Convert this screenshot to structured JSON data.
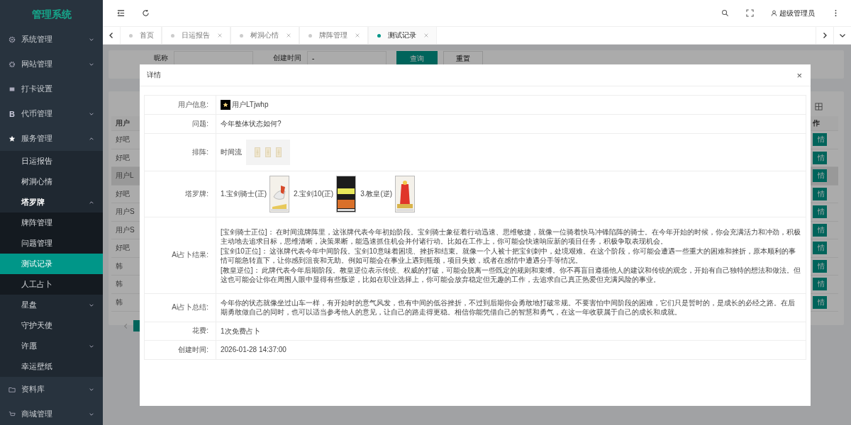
{
  "sidebar": {
    "title": "管理系统",
    "items": [
      {
        "label": "系统管理",
        "expanded": false,
        "selected": false
      },
      {
        "label": "网站管理",
        "expanded": false,
        "selected": false
      },
      {
        "label": "打卡设置",
        "selected": false
      },
      {
        "label": "代币管理",
        "glyph": "B",
        "expanded": false,
        "selected": false
      },
      {
        "label": "服务管理",
        "expanded": true,
        "selected": false,
        "children": [
          {
            "label": "日运报告",
            "selected": false
          },
          {
            "label": "树洞心情",
            "selected": false
          },
          {
            "label": "塔罗牌",
            "expanded": true,
            "selected": false,
            "children": [
              {
                "label": "牌阵管理",
                "selected": false
              },
              {
                "label": "问题管理",
                "selected": false
              },
              {
                "label": "测试记录",
                "selected": true
              },
              {
                "label": "人工占卜",
                "selected": false
              }
            ]
          },
          {
            "label": "星盘",
            "expanded": false,
            "selected": false
          },
          {
            "label": "守护天使",
            "selected": false
          },
          {
            "label": "许愿",
            "expanded": false,
            "selected": false
          },
          {
            "label": "幸运壁纸",
            "selected": false
          }
        ]
      },
      {
        "label": "资料库",
        "expanded": false,
        "selected": false
      },
      {
        "label": "商城管理",
        "expanded": false,
        "selected": false
      }
    ]
  },
  "header": {
    "user": "超级管理员"
  },
  "tabs": [
    {
      "label": "首页",
      "closable": false,
      "selected": false
    },
    {
      "label": "日运报告",
      "closable": true,
      "selected": false
    },
    {
      "label": "树洞心情",
      "closable": true,
      "selected": false
    },
    {
      "label": "牌阵管理",
      "closable": true,
      "selected": false
    },
    {
      "label": "测试记录",
      "closable": true,
      "selected": true
    }
  ],
  "search": {
    "fields": [
      {
        "label": "昵称"
      },
      {
        "label": "创建时间",
        "value": "-"
      }
    ],
    "query_button": "查询",
    "reset_button": "重置"
  },
  "table": {
    "columns": [
      "用户",
      "作"
    ],
    "rows": [
      {
        "name": "好吧",
        "action": "情",
        "selected": false
      },
      {
        "name": "好吧",
        "action": "情",
        "selected": false
      },
      {
        "name": "用户L",
        "action": "情",
        "selected": true
      },
      {
        "name": "好吧",
        "action": "情",
        "selected": false
      },
      {
        "name": "用户S",
        "action": "情",
        "selected": false
      },
      {
        "name": "用户S",
        "action": "情",
        "selected": false
      },
      {
        "name": "好吧",
        "action": "情",
        "selected": false
      },
      {
        "name": "韩",
        "action": "情",
        "selected": false
      },
      {
        "name": "韩",
        "action": "情",
        "selected": false
      },
      {
        "name": "韩",
        "action": "情",
        "selected": false
      }
    ]
  },
  "dialog": {
    "title": "详情",
    "close": "×",
    "rows": [
      {
        "kind": "user",
        "label": "用户信息:",
        "value": "用户LTjwhp"
      },
      {
        "kind": "text",
        "label": "问题:",
        "value": "今年整体状态如何?"
      },
      {
        "kind": "spread",
        "label": "排阵:",
        "value": "时间流"
      },
      {
        "kind": "cards",
        "label": "塔罗牌:",
        "cards": [
          {
            "name": "1.宝剑骑士(正)",
            "kind": "picture"
          },
          {
            "name": "2.宝剑10(正)",
            "kind": "picture"
          },
          {
            "name": "3.教皇(逆)",
            "kind": "picture"
          }
        ]
      },
      {
        "kind": "paragraphs",
        "label": "Ai占卜结果:",
        "paragraphs": [
          "[宝剑骑士正位]：  在时间流牌阵里，这张牌代表今年初始阶段。宝剑骑士象征着行动迅速、思维敏捷，就像一位骑着快马冲锋陷阵的骑士。在今年开始的时候，你会充满活力和冲劲，积极主动地去追求目标，思维清晰，决策果断，能迅速抓住机会并付诸行动。比如在工作上，你可能会快速响应新的项目任务，积极争取表现机会。",
          "[宝剑10正位]：  这张牌代表今年中间阶段。宝剑10意味着困境、挫折和结束。就像一个人被十把宝剑刺中，处境艰难。在这个阶段，你可能会遭遇一些重大的困难和挫折，原本顺利的事情可能急转直下，让你感到沮丧和无助。例如可能会在事业上遇到瓶颈，项目失败，或者在感情中遭遇分手等情况。",
          "[教皇逆位]：  此牌代表今年后期阶段。教皇逆位表示传统、权威的打破，可能会脱离一些既定的规则和束缚。你不再盲目遵循他人的建议和传统的观念，开始有自己独特的想法和做法。但这也可能会让你在周围人眼中显得有些叛逆，比如在职业选择上，你可能会放弃稳定但无趣的工作，去追求自己真正热爱但充满风险的事业。"
        ]
      },
      {
        "kind": "text",
        "label": "Ai占卜总结:",
        "value": "今年你的状态就像坐过山车一样，有开始时的意气风发，也有中间的低谷挫折，不过到后期你会勇敢地打破常规。不要害怕中间阶段的困难，它们只是暂时的，是成长的必经之路。在后期勇敢做自己的同时，也可以适当参考他人的意见，让自己的路走得更稳。相信你能凭借自己的智慧和勇气，在这一年收获属于自己的成长和成就。"
      },
      {
        "kind": "text",
        "label": "花费:",
        "value": "1次免费占卜"
      },
      {
        "kind": "text",
        "label": "创建时间:",
        "value": "2026-01-28 14:37:00"
      }
    ]
  }
}
